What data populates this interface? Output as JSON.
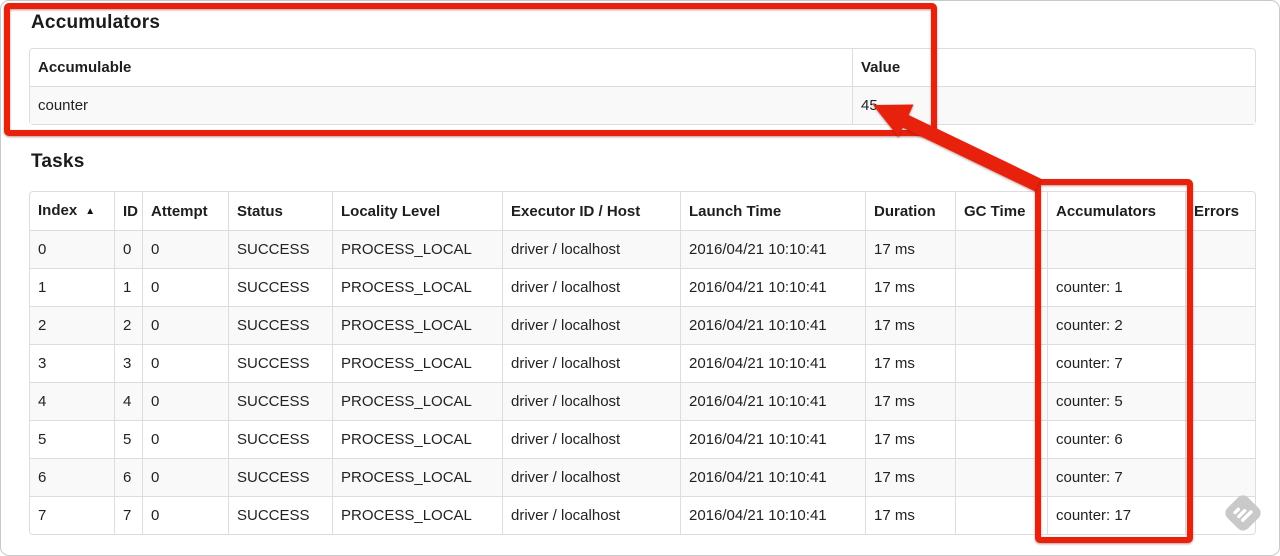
{
  "accumulators_section": {
    "heading": "Accumulators",
    "table": {
      "headers": [
        {
          "label": "Accumulable"
        },
        {
          "label": "Value"
        }
      ],
      "rows": [
        [
          "counter",
          "45"
        ]
      ]
    }
  },
  "tasks_section": {
    "heading": "Tasks",
    "table": {
      "headers": [
        {
          "label": "Index",
          "sort_icon": "▲"
        },
        {
          "label": "ID"
        },
        {
          "label": "Attempt"
        },
        {
          "label": "Status"
        },
        {
          "label": "Locality Level"
        },
        {
          "label": "Executor ID / Host"
        },
        {
          "label": "Launch Time"
        },
        {
          "label": "Duration"
        },
        {
          "label": "GC Time"
        },
        {
          "label": "Accumulators"
        },
        {
          "label": "Errors"
        }
      ],
      "rows": [
        [
          "0",
          "0",
          "0",
          "SUCCESS",
          "PROCESS_LOCAL",
          "driver / localhost",
          "2016/04/21 10:10:41",
          "17 ms",
          "",
          "",
          ""
        ],
        [
          "1",
          "1",
          "0",
          "SUCCESS",
          "PROCESS_LOCAL",
          "driver / localhost",
          "2016/04/21 10:10:41",
          "17 ms",
          "",
          "counter: 1",
          ""
        ],
        [
          "2",
          "2",
          "0",
          "SUCCESS",
          "PROCESS_LOCAL",
          "driver / localhost",
          "2016/04/21 10:10:41",
          "17 ms",
          "",
          "counter: 2",
          ""
        ],
        [
          "3",
          "3",
          "0",
          "SUCCESS",
          "PROCESS_LOCAL",
          "driver / localhost",
          "2016/04/21 10:10:41",
          "17 ms",
          "",
          "counter: 7",
          ""
        ],
        [
          "4",
          "4",
          "0",
          "SUCCESS",
          "PROCESS_LOCAL",
          "driver / localhost",
          "2016/04/21 10:10:41",
          "17 ms",
          "",
          "counter: 5",
          ""
        ],
        [
          "5",
          "5",
          "0",
          "SUCCESS",
          "PROCESS_LOCAL",
          "driver / localhost",
          "2016/04/21 10:10:41",
          "17 ms",
          "",
          "counter: 6",
          ""
        ],
        [
          "6",
          "6",
          "0",
          "SUCCESS",
          "PROCESS_LOCAL",
          "driver / localhost",
          "2016/04/21 10:10:41",
          "17 ms",
          "",
          "counter: 7",
          ""
        ],
        [
          "7",
          "7",
          "0",
          "SUCCESS",
          "PROCESS_LOCAL",
          "driver / localhost",
          "2016/04/21 10:10:41",
          "17 ms",
          "",
          "counter: 17",
          ""
        ]
      ]
    }
  },
  "annotations": {
    "highlight_color": "#e8210d"
  },
  "icons": {
    "sort_ascending_icon": "▲",
    "watermark_icon": "feedly-watermark-icon",
    "watermark_color": "#c9c9c9"
  }
}
